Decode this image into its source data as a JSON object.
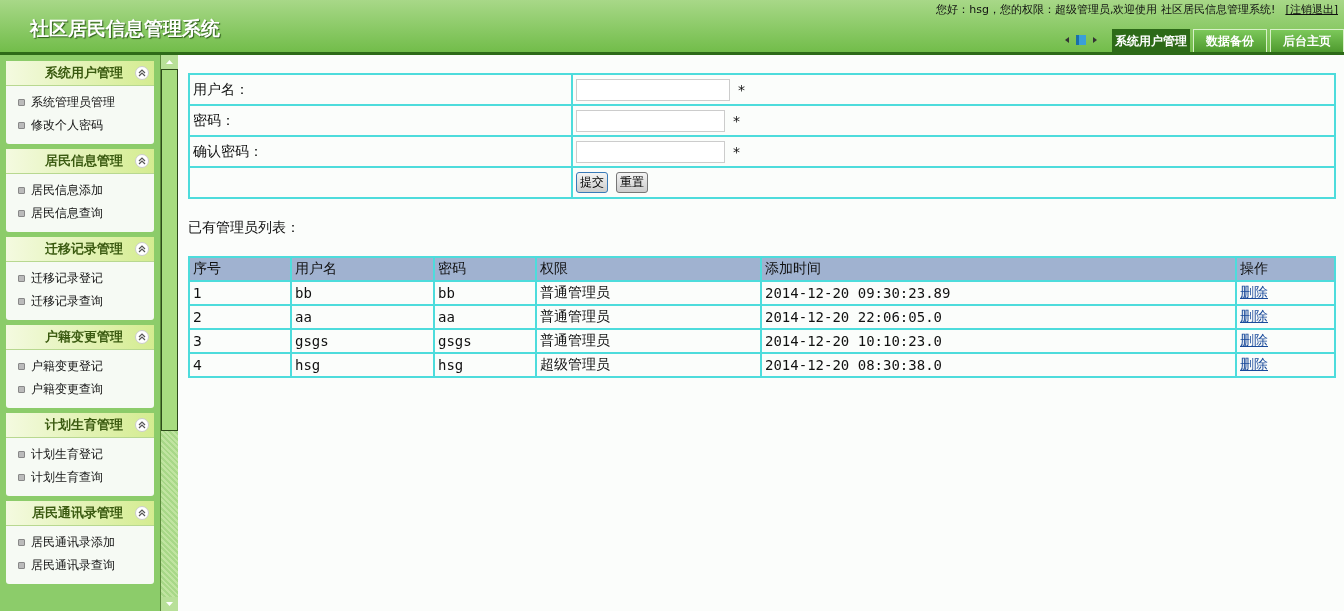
{
  "header": {
    "title": "社区居民信息管理系统",
    "greeting": "您好：hsg，您的权限：超级管理员,欢迎使用 社区居民信息管理系统!",
    "logout": "[注销退出]",
    "tabs": [
      {
        "label": "系统用户管理",
        "selected": true
      },
      {
        "label": "数据备份",
        "selected": false
      },
      {
        "label": "后台主页",
        "selected": false
      }
    ]
  },
  "sidebar": {
    "sections": [
      {
        "title": "系统用户管理",
        "expanded": true,
        "items": [
          "系统管理员管理",
          "修改个人密码"
        ]
      },
      {
        "title": "居民信息管理",
        "expanded": true,
        "items": [
          "居民信息添加",
          "居民信息查询"
        ]
      },
      {
        "title": "迁移记录管理",
        "expanded": true,
        "items": [
          "迁移记录登记",
          "迁移记录查询"
        ]
      },
      {
        "title": "户籍变更管理",
        "expanded": true,
        "items": [
          "户籍变更登记",
          "户籍变更查询"
        ]
      },
      {
        "title": "计划生育管理",
        "expanded": true,
        "items": [
          "计划生育登记",
          "计划生育查询"
        ]
      },
      {
        "title": "居民通讯录管理",
        "expanded": true,
        "items": [
          "居民通讯录添加",
          "居民通讯录查询"
        ]
      }
    ]
  },
  "form": {
    "fields": [
      {
        "label": "用户名：",
        "required": "*"
      },
      {
        "label": "密码：",
        "required": "*"
      },
      {
        "label": "确认密码：",
        "required": "*"
      }
    ],
    "buttons": [
      "提交",
      "重置"
    ]
  },
  "list_title": "已有管理员列表：",
  "table": {
    "columns": [
      "序号",
      "用户名",
      "密码",
      "权限",
      "添加时间",
      "操作"
    ],
    "rows": [
      [
        "1",
        "bb",
        "bb",
        "普通管理员",
        "2014-12-20 09:30:23.89",
        "删除"
      ],
      [
        "2",
        "aa",
        "aa",
        "普通管理员",
        "2014-12-20 22:06:05.0",
        "删除"
      ],
      [
        "3",
        "gsgs",
        "gsgs",
        "普通管理员",
        "2014-12-20 10:10:23.0",
        "删除"
      ],
      [
        "4",
        "hsg",
        "hsg",
        "超级管理员",
        "2014-12-20 08:30:38.0",
        "删除"
      ]
    ]
  }
}
